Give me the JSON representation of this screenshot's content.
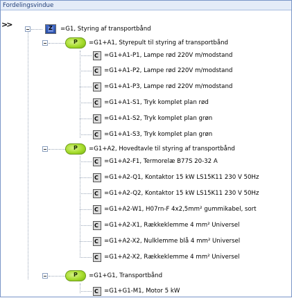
{
  "window": {
    "title": "Fordelingsvindue"
  },
  "tree": {
    "root": {
      "label": "=G1, Styring af transportbånd",
      "icon": "system-icon"
    },
    "groups": [
      {
        "label": "=G1+A1, Styrepult til styring af transportbånd",
        "icon": "assembly-icon",
        "items": [
          "=G1+A1-P1, Lampe rød 220V m/modstand",
          "=G1+A1-P2, Lampe rød 220V m/modstand",
          "=G1+A1-P3, Lampe rød 220V m/modstand",
          "=G1+A1-S1, Tryk komplet plan rød",
          "=G1+A1-S2, Tryk komplet plan grøn",
          "=G1+A1-S3, Tryk komplet plan grøn"
        ]
      },
      {
        "label": "=G1+A2, Hovedtavle til styring af transportbånd",
        "icon": "assembly-icon",
        "items": [
          "=G1+A2-F1, Termorelæ B77S 20-32 A",
          "=G1+A2-Q1, Kontaktor 15 kW LS15K11 230 V 50Hz",
          "=G1+A2-Q2, Kontaktor 15 kW LS15K11 230 V 50Hz",
          "=G1+A2-W1, H07rn-F 4x2,5mm² gummikabel, sort",
          "=G1+A2-X1, Rækkeklemme 4 mm² Universel",
          "=G1+A2-X2, Nulklemme blå 4 mm² Universel",
          "=G1+A2-X2, Rækkeklemme 4 mm² Universel"
        ]
      },
      {
        "label": "=G1+G1, Transportbånd",
        "icon": "assembly-icon",
        "items": [
          "=G1+G1-M1, Motor 5 kW"
        ]
      }
    ]
  }
}
